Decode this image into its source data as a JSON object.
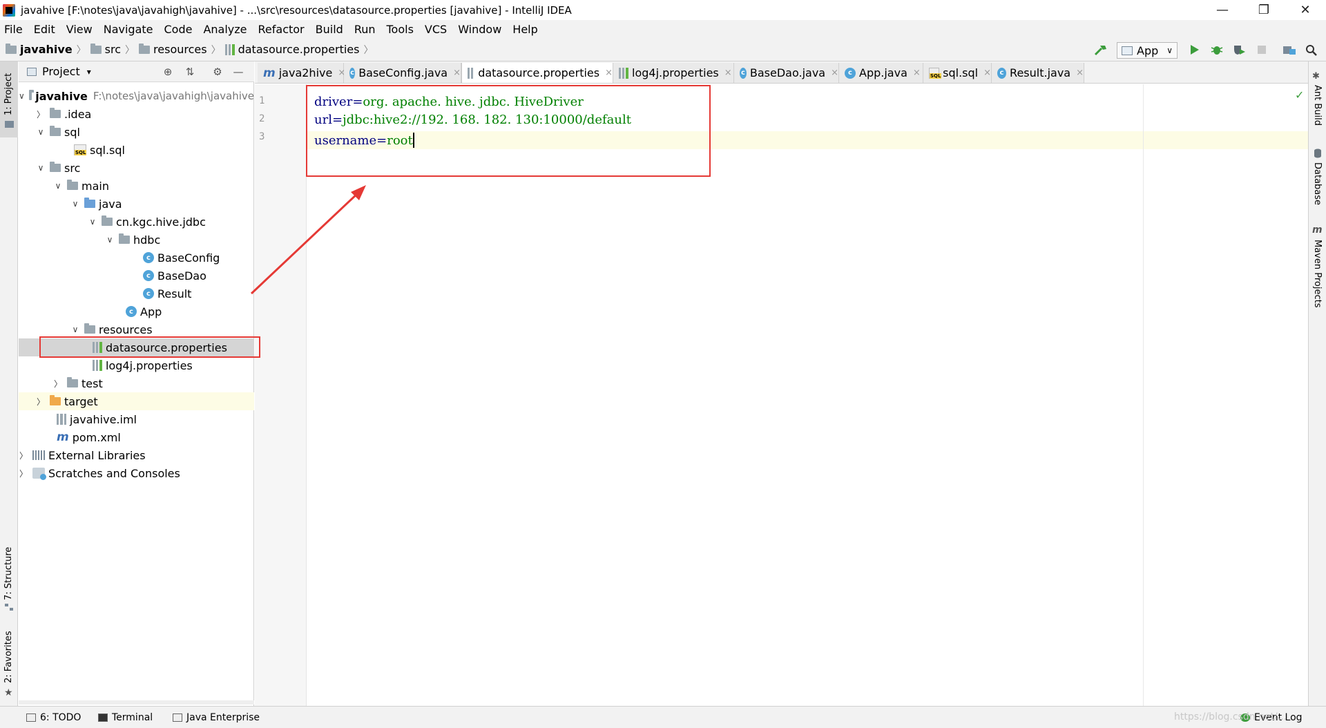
{
  "window": {
    "title": "javahive [F:\\notes\\java\\javahigh\\javahive] - ...\\src\\resources\\datasource.properties [javahive] - IntelliJ IDEA",
    "minimize": "—",
    "restore": "❐",
    "close": "✕"
  },
  "menu": [
    "File",
    "Edit",
    "View",
    "Navigate",
    "Code",
    "Analyze",
    "Refactor",
    "Build",
    "Run",
    "Tools",
    "VCS",
    "Window",
    "Help"
  ],
  "breadcrumb": {
    "items": [
      "javahive",
      "src",
      "resources",
      "datasource.properties"
    ],
    "separator": "〉"
  },
  "toolbar": {
    "run_config": "App",
    "dropdown": "∨"
  },
  "stripes": {
    "left_top": "1: Project",
    "left_structure": "7: Structure",
    "left_favorites": "2: Favorites",
    "right_ant": "Ant Build",
    "right_database": "Database",
    "right_maven": "Maven Projects"
  },
  "project_panel": {
    "title": "Project",
    "title_arrow": "▾",
    "tree": [
      {
        "label": "javahive",
        "hint": "F:\\notes\\java\\javahigh\\javahive",
        "arrow": "∨"
      },
      {
        "label": ".idea",
        "arrow": "〉"
      },
      {
        "label": "sql",
        "arrow": "∨"
      },
      {
        "label": "sql.sql"
      },
      {
        "label": "src",
        "arrow": "∨"
      },
      {
        "label": "main",
        "arrow": "∨"
      },
      {
        "label": "java",
        "arrow": "∨"
      },
      {
        "label": "cn.kgc.hive.jdbc",
        "arrow": "∨"
      },
      {
        "label": "hdbc",
        "arrow": "∨"
      },
      {
        "label": "BaseConfig"
      },
      {
        "label": "BaseDao"
      },
      {
        "label": "Result"
      },
      {
        "label": "App"
      },
      {
        "label": "resources",
        "arrow": "∨"
      },
      {
        "label": "datasource.properties"
      },
      {
        "label": "log4j.properties"
      },
      {
        "label": "test",
        "arrow": "〉"
      },
      {
        "label": "target",
        "arrow": "〉"
      },
      {
        "label": "javahive.iml"
      },
      {
        "label": "pom.xml"
      },
      {
        "label": "External Libraries",
        "arrow": "〉"
      },
      {
        "label": "Scratches and Consoles",
        "arrow": "〉"
      }
    ]
  },
  "icons": {
    "class_letter": "c",
    "maven_letter": "m",
    "locate": "⊕",
    "collapse": "⇅",
    "gear": "⚙",
    "hide": "—",
    "check": "✓"
  },
  "tabs": [
    {
      "label": "java2hive",
      "close": "×"
    },
    {
      "label": "BaseConfig.java",
      "close": "×"
    },
    {
      "label": "datasource.properties",
      "close": "×"
    },
    {
      "label": "log4j.properties",
      "close": "×"
    },
    {
      "label": "BaseDao.java",
      "close": "×"
    },
    {
      "label": "App.java",
      "close": "×"
    },
    {
      "label": "sql.sql",
      "close": "×"
    },
    {
      "label": "Result.java",
      "close": "×"
    }
  ],
  "editor": {
    "lines": [
      {
        "num": "1",
        "key": "driver",
        "eq": "=",
        "val": "org. apache. hive. jdbc. HiveDriver"
      },
      {
        "num": "2",
        "key": "url",
        "eq": "=",
        "val": "jdbc:hive2://192. 168. 182. 130:10000/default"
      },
      {
        "num": "3",
        "key": "username",
        "eq": "=",
        "val": "root"
      }
    ]
  },
  "statusbar": {
    "todo": "6: TODO",
    "terminal": "Terminal",
    "java_enterprise": "Java Enterprise",
    "event_log": "Event Log",
    "watermark": "https://blog.csdn.net/..."
  },
  "colors": {
    "annotation": "#e53935",
    "property_key": "#000080",
    "property_value": "#008000"
  }
}
